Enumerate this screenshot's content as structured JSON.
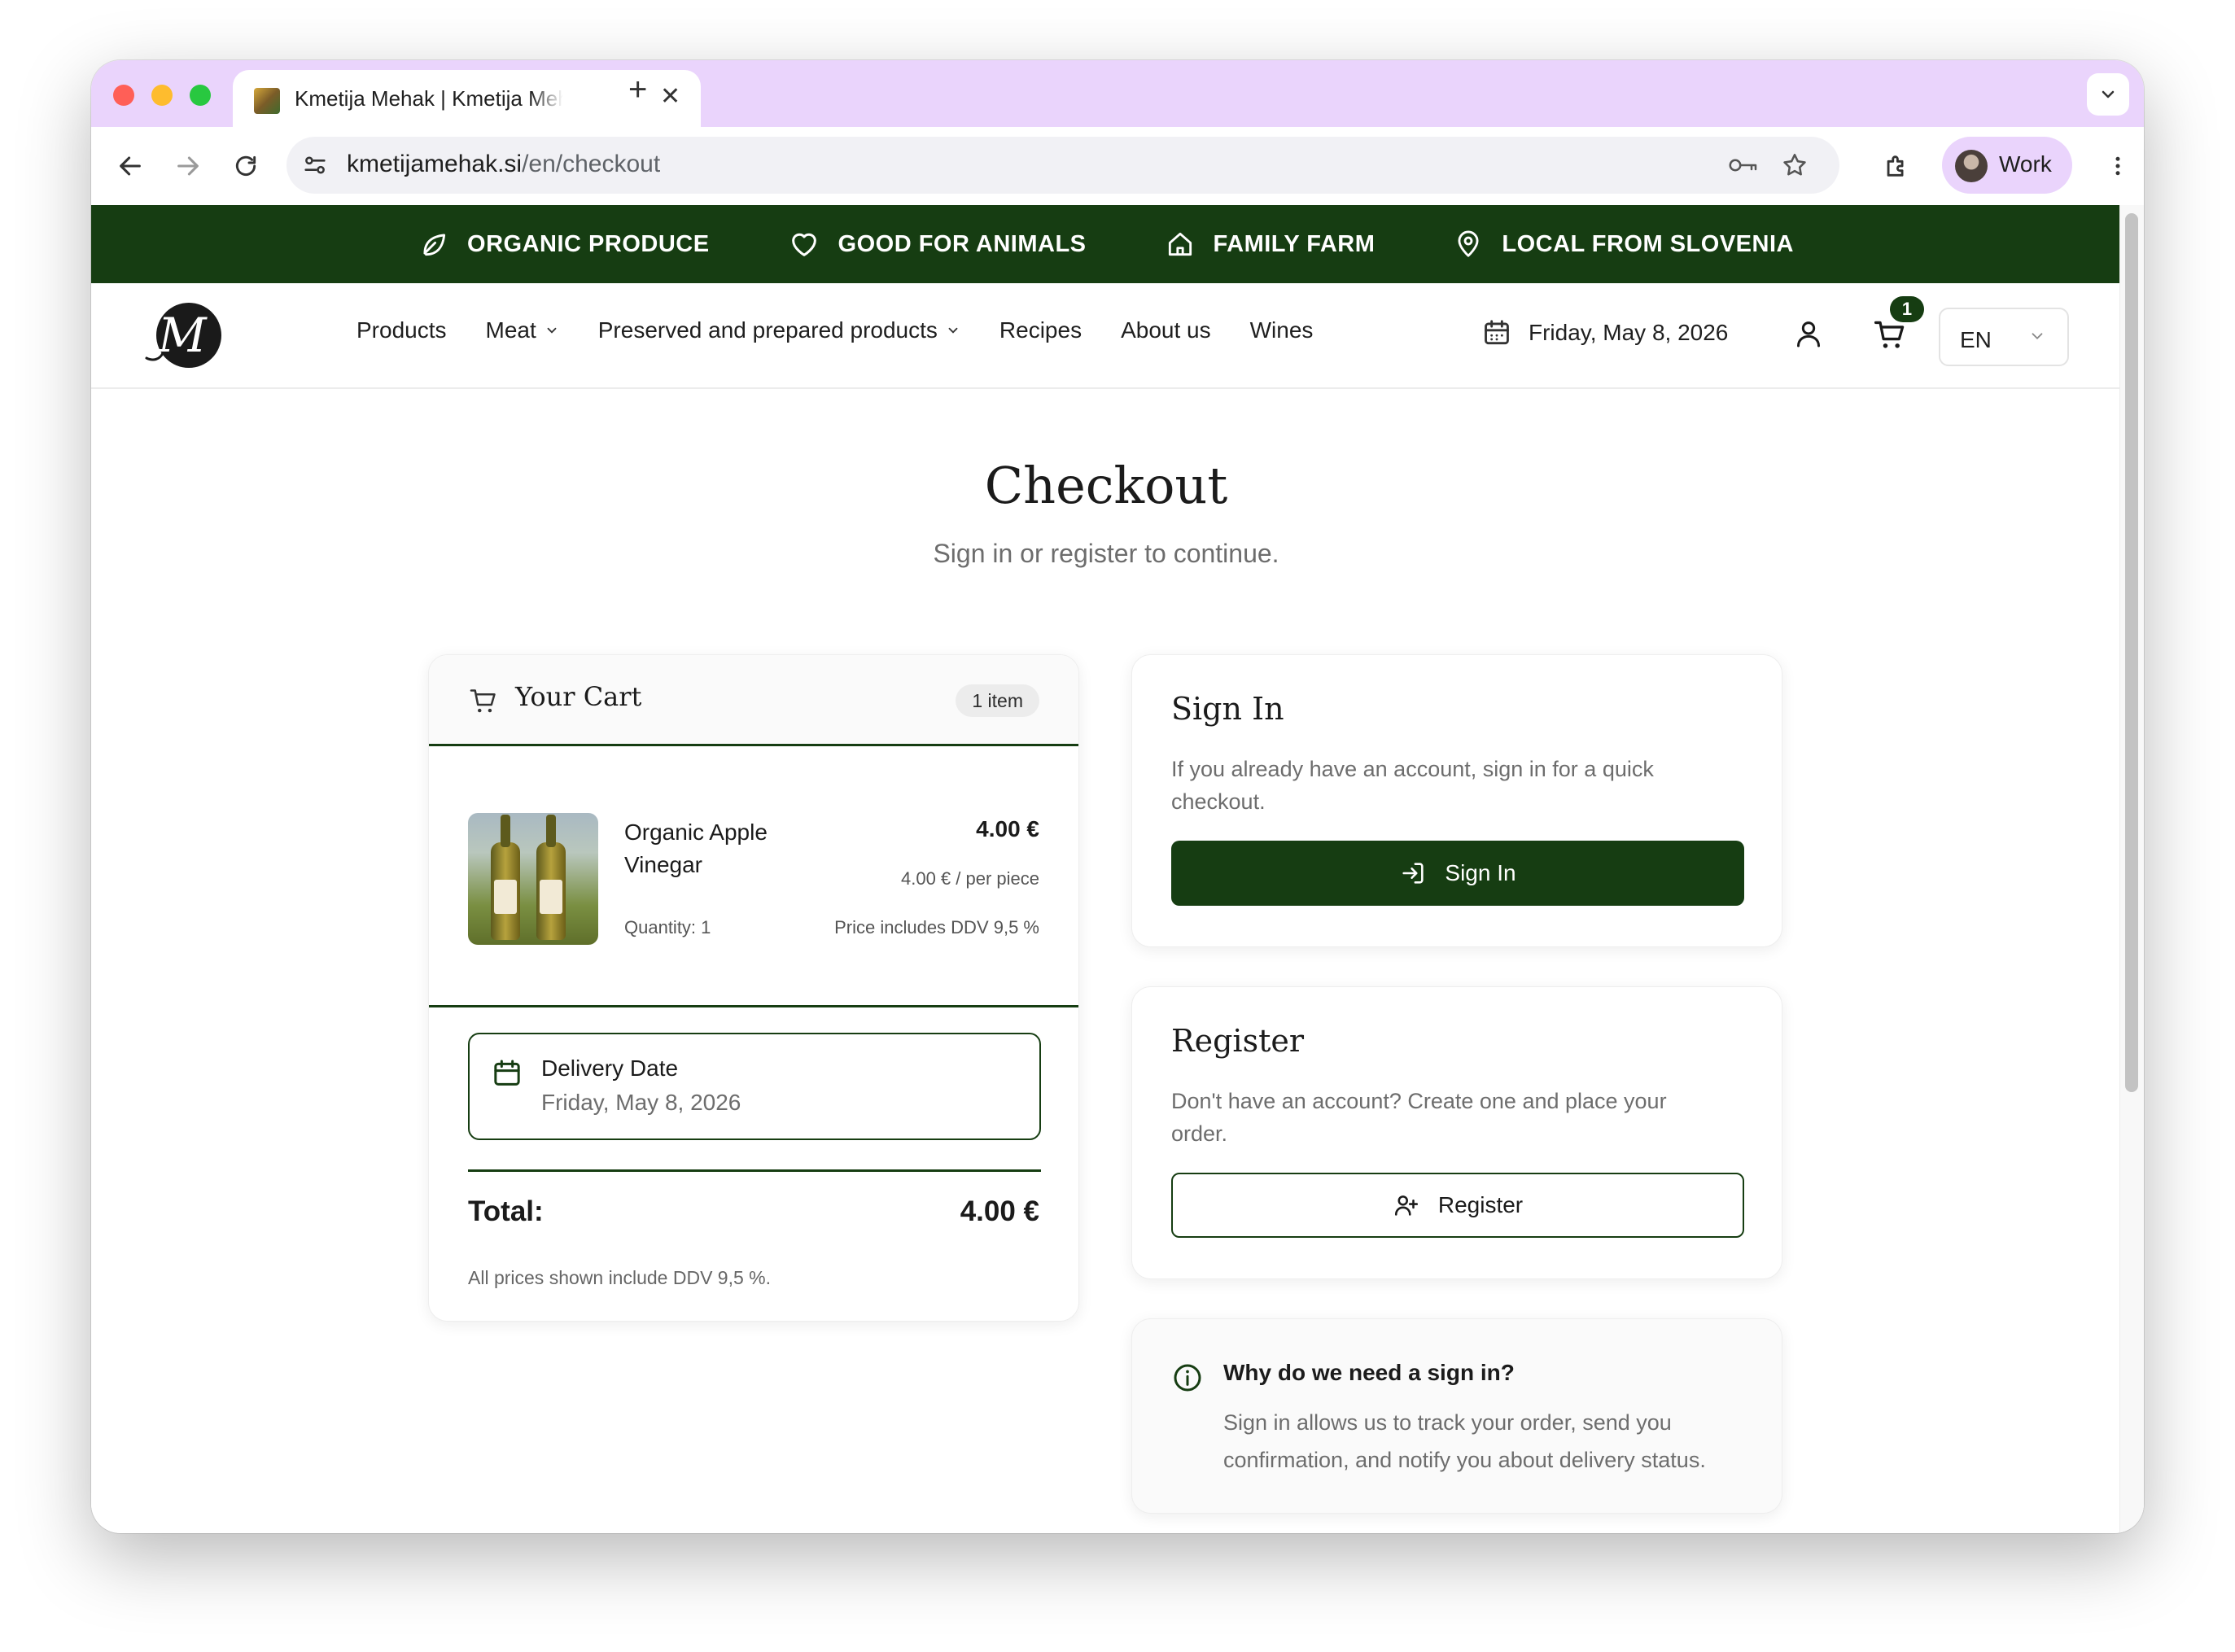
{
  "browser": {
    "tab_title": "Kmetija Mehak | Kmetija Mehak",
    "url_host": "kmetijamehak.si",
    "url_path": "/en/checkout",
    "profile_label": "Work"
  },
  "promo": {
    "items": [
      {
        "label": "ORGANIC PRODUCE",
        "icon": "leaf-icon"
      },
      {
        "label": "GOOD FOR ANIMALS",
        "icon": "heart-icon"
      },
      {
        "label": "FAMILY FARM",
        "icon": "home-icon"
      },
      {
        "label": "LOCAL FROM SLOVENIA",
        "icon": "location-pin-icon"
      }
    ]
  },
  "header": {
    "logo_letter": "M",
    "nav": [
      "Products",
      "Meat",
      "Preserved and prepared products",
      "Recipes",
      "About us",
      "Wines"
    ],
    "date": "Friday, May 8, 2026",
    "cart_count": "1",
    "language": "EN"
  },
  "page": {
    "title": "Checkout",
    "subtitle": "Sign in or register to continue."
  },
  "cart": {
    "title": "Your Cart",
    "count_label": "1 item",
    "product": {
      "name": "Organic Apple Vinegar",
      "price": "4.00 €",
      "unit_price": "4.00 € / per piece",
      "quantity": "Quantity: 1",
      "tax_note": "Price includes DDV 9,5 %"
    },
    "delivery_label": "Delivery Date",
    "delivery_value": "Friday, May 8, 2026",
    "total_label": "Total:",
    "total_value": "4.00 €",
    "prices_note": "All prices shown include DDV 9,5 %."
  },
  "signin": {
    "title": "Sign In",
    "text": "If you already have an account, sign in for a quick checkout.",
    "button": "Sign In"
  },
  "register": {
    "title": "Register",
    "text": "Don't have an account? Create one and place your order.",
    "button": "Register"
  },
  "info": {
    "title": "Why do we need a sign in?",
    "text": "Sign in allows us to track your order, send you confirmation, and notify you about delivery status."
  },
  "colors": {
    "brand_green": "#163d12",
    "tab_strip": "#ead4fc"
  }
}
